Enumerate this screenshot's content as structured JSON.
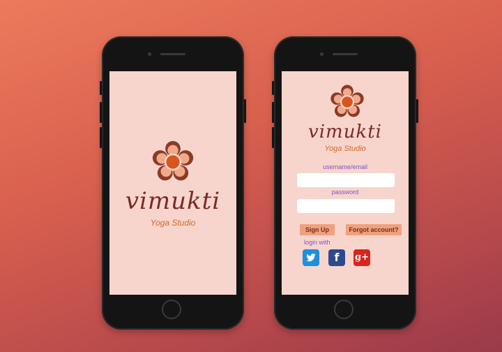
{
  "splash": {
    "brand": "vimukti",
    "tagline": "Yoga Studio"
  },
  "login": {
    "brand": "vimukti",
    "tagline": "Yoga Studio",
    "username_label": "username/email",
    "password_label": "password",
    "signup_label": "Sign Up",
    "forgot_label": "Forgot account?",
    "login_with_label": "login with",
    "social": {
      "twitter_glyph": "",
      "facebook_glyph": "f",
      "google_glyph": "g+"
    }
  },
  "colors": {
    "screen_bg": "#f8d5cc",
    "brand_text": "#7a2a22",
    "tagline_text": "#d0692a",
    "label_text": "#7c52d6",
    "button_bg": "#f0a07c",
    "twitter": "#1d8fe0",
    "facebook": "#2d4b8c",
    "google": "#d8261e"
  },
  "icons": [
    "flower-logo-icon",
    "twitter-icon",
    "facebook-icon",
    "google-plus-icon"
  ]
}
